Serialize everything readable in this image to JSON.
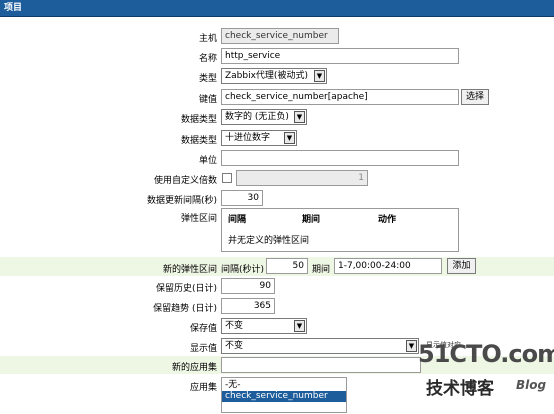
{
  "header": {
    "title": "项目"
  },
  "form": {
    "host_label": "主机",
    "host_value": "check_service_number",
    "name_label": "名称",
    "name_value": "http_service",
    "type_label": "类型",
    "type_value": "Zabbix代理(被动式)",
    "key_label": "键值",
    "key_value": "check_service_number[apache]",
    "key_select_button": "选择",
    "data_type_label": "数据类型",
    "data_type_value": "数字的 (无正负)",
    "data_type2_label": "数据类型",
    "data_type2_value": "十进位数字",
    "units_label": "单位",
    "units_value": "",
    "custom_multiplier_label": "使用自定义倍数",
    "custom_multiplier_value": "1",
    "update_interval_label": "数据更新间隔(秒)",
    "update_interval_value": "30",
    "flex_label": "弹性区间",
    "flex_headers": {
      "interval": "间隔",
      "period": "期间",
      "action": "动作"
    },
    "flex_empty": "并无定义的弹性区间",
    "new_flex_label": "新的弹性区间",
    "new_flex_interval_label": "间隔(秒计)",
    "new_flex_interval_value": "50",
    "new_flex_period_label": "期间",
    "new_flex_period_value": "1-7,00:00-24:00",
    "new_flex_add_button": "添加",
    "history_label": "保留历史(日计)",
    "history_value": "90",
    "trends_label": "保留趋势 (日计)",
    "trends_value": "365",
    "store_value_label": "保存值",
    "store_value_value": "不变",
    "show_value_label": "显示值",
    "show_value_value": "不变",
    "show_value_mapping_link": "显示值对应",
    "new_application_label": "新的应用集",
    "new_application_value": "",
    "applications_label": "应用集",
    "applications_options": [
      "-无-",
      "check_service_number"
    ]
  },
  "watermark": {
    "site": "51CTO.com",
    "sub": "技术博客",
    "blog": "Blog"
  },
  "colors": {
    "header_bg": "#1e5d9c",
    "shade_row": "#eef6e4",
    "selected_option": "#1e5d9c"
  }
}
